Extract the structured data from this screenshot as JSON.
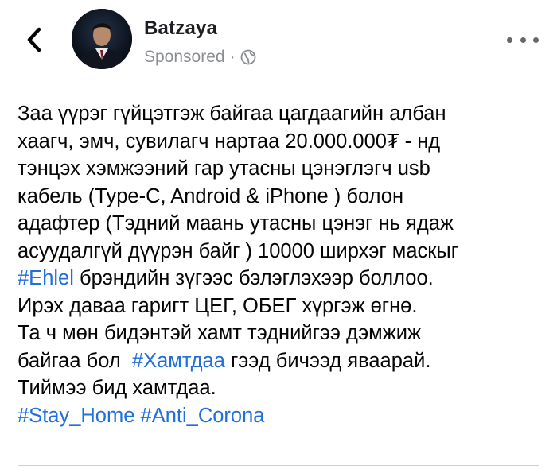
{
  "header": {
    "author_name": "Batzaya",
    "sponsored_label": "Sponsored",
    "separator": "·",
    "privacy_icon": "globe-icon",
    "back_icon": "chevron-left-icon",
    "more_icon": "more-horizontal-icon"
  },
  "post": {
    "line1": "Заа үүрэг гүйцэтгэж байгаа цагдаагийн албан",
    "line2": "хаагч, эмч, сувилагч нартаа 20.000.000₮ - нд",
    "line3": "тэнцэх хэмжээний гар утасны цэнэглэгч usb",
    "line4": "кабель (Type-C, Android & iPhone ) болон",
    "line5": "адафтер (Тэдний маань утасны цэнэг нь ядаж",
    "line6": "асуудалгүй дүүрэн байг ) 10000 ширхэг маскыг",
    "line7_tag": "#Ehlel",
    "line7_text": " брэндийн зүгээс бэлэглэхээр боллоо.",
    "line8": "Ирэх даваа гаригт ЦЕГ, ОБЕГ хүргэж өгнө.",
    "line9": "Та ч мөн бидэнтэй хамт тэднийгээ дэмжиж",
    "line10_pre": "байгаа бол  ",
    "line10_tag": "#Хамтдаа",
    "line10_post": " гээд бичээд яваарай.",
    "line11": "Тиймээ бид хамтдаа.",
    "line12_tag1": "#Stay_Home",
    "line12_sep": " ",
    "line12_tag2": "#Anti_Corona"
  },
  "colors": {
    "hashtag": "#216fdb",
    "meta_text": "#8a8d91",
    "body_text": "#050505"
  }
}
